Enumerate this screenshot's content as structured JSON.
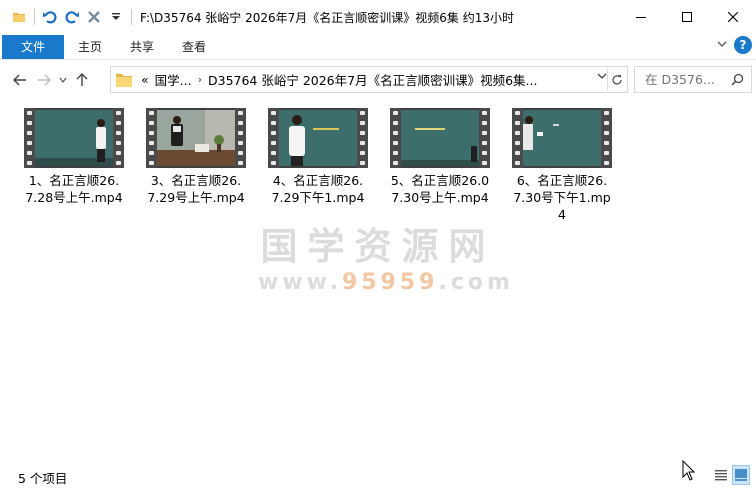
{
  "window": {
    "title": "F:\\D35764 张峪宁 2026年7月《名正言顺密训课》视频6集 约13小时",
    "controls": [
      "minimize",
      "maximize",
      "close"
    ]
  },
  "ribbon": {
    "file_tab": "文件",
    "tabs": [
      "主页",
      "共享",
      "查看"
    ]
  },
  "address": {
    "prefix": "«",
    "crumbs": [
      "国学...",
      "D35764 张峪宁 2026年7月《名正言顺密训课》视频6集..."
    ],
    "search_placeholder": "在 D3576..."
  },
  "files": [
    {
      "name": "1、名正言顺26.7.28号上午.mp4",
      "thumb": "teacher-right"
    },
    {
      "name": "3、名正言顺26.7.29号上午.mp4",
      "thumb": "classroom"
    },
    {
      "name": "4、名正言顺26.7.29下午1.mp4",
      "thumb": "teacher-left"
    },
    {
      "name": "5、名正言顺26.07.30号上午.mp4",
      "thumb": "board"
    },
    {
      "name": "6、名正言顺26.7.30号下午1.mp4",
      "thumb": "teacher-edge"
    }
  ],
  "watermark": {
    "line1": "国学资源网",
    "line2_prefix": "www.",
    "line2_highlight": "95959",
    "line2_suffix": ".com"
  },
  "status": {
    "count": "5 个项目"
  },
  "colors": {
    "accent": "#1979ca",
    "board": "#3b6b6a"
  }
}
